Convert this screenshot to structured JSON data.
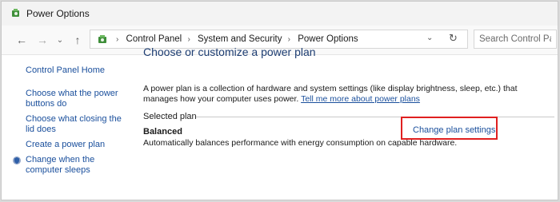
{
  "window": {
    "title": "Power Options"
  },
  "address_bar": {
    "breadcrumbs": [
      "Control Panel",
      "System and Security",
      "Power Options"
    ]
  },
  "search": {
    "placeholder": "Search Control Panel"
  },
  "sidebar": {
    "home": "Control Panel Home",
    "items": [
      {
        "label": "Choose what the power buttons do"
      },
      {
        "label": "Choose what closing the lid does"
      },
      {
        "label": "Create a power plan"
      },
      {
        "label": "Change when the computer sleeps",
        "icon": "shield-icon"
      }
    ]
  },
  "main": {
    "heading": "Choose or customize a power plan",
    "description": "A power plan is a collection of hardware and system settings (like display brightness, sleep, etc.) that manages how your computer uses power.",
    "tell_me_more": "Tell me more about power plans",
    "selected_plan_label": "Selected plan",
    "plan_name": "Balanced",
    "plan_description": "Automatically balances performance with energy consumption on capable hardware.",
    "change_plan_link": "Change plan settings"
  },
  "colors": {
    "link": "#1a4f9c",
    "heading": "#1e3e73",
    "highlight_box": "#e02020"
  }
}
